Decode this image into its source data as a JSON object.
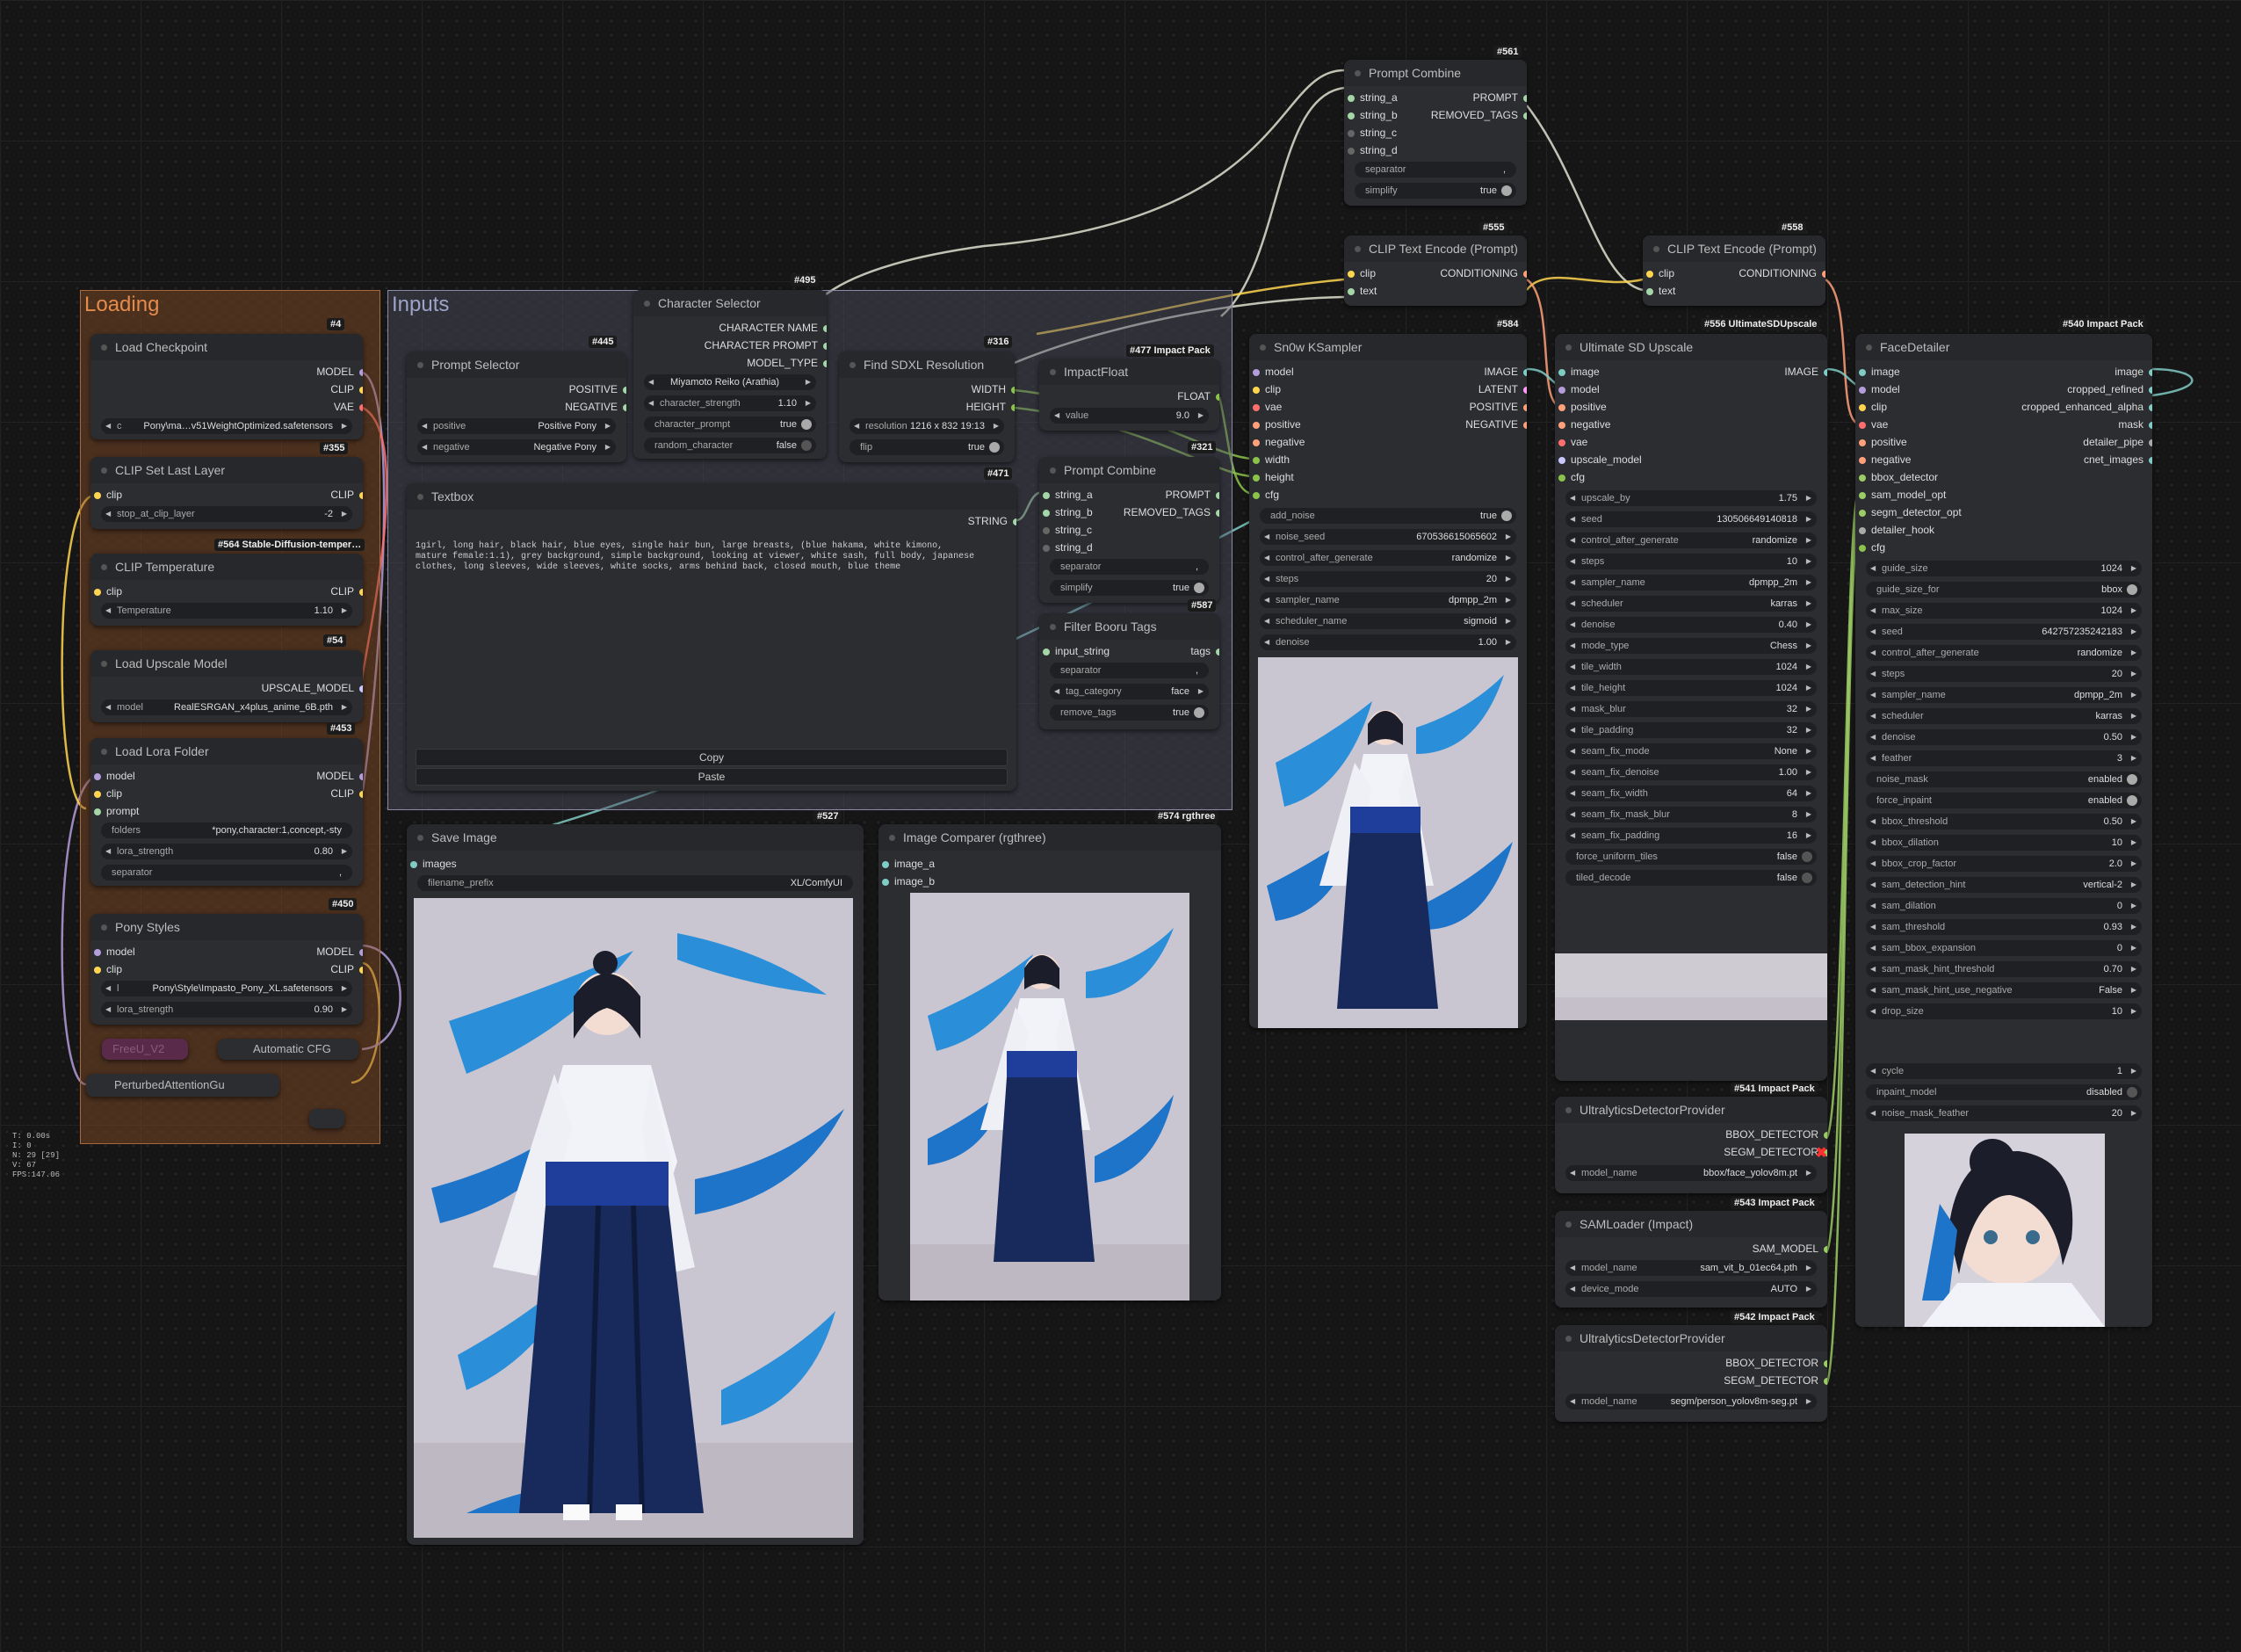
{
  "groups": {
    "loading": "Loading",
    "inputs": "Inputs"
  },
  "stats": [
    "T: 0.00s",
    "I: 0",
    "N: 29 [29]",
    "V: 67",
    "FPS:147.06"
  ],
  "textbox_text": "1girl, long hair, black hair, blue eyes, single hair bun, large breasts, (blue hakama, white kimono, mature female:1.1), grey background, simple background, looking at viewer, white sash, full body, japanese clothes, long sleeves, wide sleeves, white socks, arms behind back, closed mouth, blue theme",
  "nodes": {
    "load_checkpoint": {
      "title": "Load Checkpoint",
      "badge": "#4",
      "out": [
        "MODEL",
        "CLIP",
        "VAE"
      ],
      "ckpt": "Pony\\ma…v51WeightOptimized.safetensors",
      "ckpt_label": "c"
    },
    "clip_set_last": {
      "title": "CLIP Set Last Layer",
      "badge": "#355",
      "in": "clip",
      "out": "CLIP",
      "w_label": "stop_at_clip_layer",
      "w_val": "-2"
    },
    "clip_temp": {
      "title": "CLIP Temperature",
      "badge": "#564 Stable-Diffusion-temper…",
      "in": "clip",
      "out": "CLIP",
      "w_label": "Temperature",
      "w_val": "1.10"
    },
    "load_upscale": {
      "title": "Load Upscale Model",
      "badge": "#54",
      "out": "UPSCALE_MODEL",
      "w_label": "model",
      "w_val": "RealESRGAN_x4plus_anime_6B.pth"
    },
    "lora_folder": {
      "title": "Load Lora Folder",
      "badge": "#453",
      "in": [
        "model",
        "clip",
        "prompt"
      ],
      "out": [
        "MODEL",
        "CLIP"
      ],
      "folders_label": "folders",
      "folders_val": "*pony,character:1,concept,-sty",
      "lora_strength": "0.80",
      "separator_label": "separator",
      "separator_val": ","
    },
    "pony_styles": {
      "title": "Pony Styles",
      "badge": "#450",
      "in": [
        "model",
        "clip"
      ],
      "out": [
        "MODEL",
        "CLIP"
      ],
      "lora_label": "l",
      "lora_val": "Pony\\Style\\Impasto_Pony_XL.safetensors",
      "strength": "0.90"
    },
    "freeu": {
      "title": "FreeU_V2"
    },
    "auto_cfg": {
      "title": "Automatic CFG"
    },
    "pag": {
      "title": "PerturbedAttentionGu"
    },
    "prompt_selector": {
      "title": "Prompt Selector",
      "badge": "#445",
      "out": [
        "POSITIVE",
        "NEGATIVE"
      ],
      "positive": "Positive Pony",
      "negative": "Negative Pony",
      "positive_label": "positive",
      "negative_label": "negative"
    },
    "char_selector": {
      "title": "Character Selector",
      "badge": "#495",
      "out": [
        "CHARACTER NAME",
        "CHARACTER PROMPT",
        "MODEL_TYPE"
      ],
      "character": "Miyamoto Reiko (Arathia)",
      "character_strength": "1.10",
      "character_prompt": "true",
      "random_character": "false"
    },
    "sdxl_res": {
      "title": "Find SDXL Resolution",
      "badge": "#316",
      "out": [
        "WIDTH",
        "HEIGHT"
      ],
      "resolution": "1216 x 832 19:13",
      "resolution_label": "resolution",
      "flip": "true"
    },
    "textbox": {
      "title": "Textbox",
      "badge": "#471",
      "out": "STRING",
      "copy": "Copy",
      "paste": "Paste"
    },
    "impact_float": {
      "title": "ImpactFloat",
      "badge": "#477 Impact Pack",
      "out": "FLOAT",
      "w_label": "value",
      "w_val": "9.0"
    },
    "prompt_combine2": {
      "title": "Prompt Combine",
      "badge": "#321",
      "in": [
        "string_a",
        "string_b",
        "string_c",
        "string_d"
      ],
      "out": [
        "PROMPT",
        "REMOVED_TAGS"
      ],
      "separator": ",",
      "simplify": "true"
    },
    "filter_booru": {
      "title": "Filter Booru Tags",
      "badge": "#587",
      "in": "input_string",
      "out": "tags",
      "separator": ",",
      "tag_category": "face",
      "remove_tags": "true"
    },
    "prompt_combine1": {
      "title": "Prompt Combine",
      "badge": "#561",
      "in": [
        "string_a",
        "string_b",
        "string_c",
        "string_d"
      ],
      "out": [
        "PROMPT",
        "REMOVED_TAGS"
      ],
      "separator": ",",
      "simplify": "true"
    },
    "clip_text1": {
      "title": "CLIP Text Encode (Prompt)",
      "badge": "#555",
      "in": [
        "clip",
        "text"
      ],
      "out": "CONDITIONING"
    },
    "clip_text2": {
      "title": "CLIP Text Encode (Prompt)",
      "badge": "#558",
      "in": [
        "clip",
        "text"
      ],
      "out": "CONDITIONING"
    },
    "ksampler": {
      "title": "Sn0w KSampler",
      "badge": "#584",
      "in": [
        "model",
        "clip",
        "vae",
        "positive",
        "negative",
        "width",
        "height",
        "cfg"
      ],
      "out": [
        "IMAGE",
        "LATENT",
        "POSITIVE",
        "NEGATIVE"
      ],
      "widgets": [
        [
          "add_noise",
          "true",
          "t"
        ],
        [
          "noise_seed",
          "670536615065602",
          "a"
        ],
        [
          "control_after_generate",
          "randomize",
          "a"
        ],
        [
          "steps",
          "20",
          "a"
        ],
        [
          "sampler_name",
          "dpmpp_2m",
          "a"
        ],
        [
          "scheduler_name",
          "sigmoid",
          "a"
        ],
        [
          "denoise",
          "1.00",
          "a"
        ]
      ]
    },
    "ultimate_sd": {
      "title": "Ultimate SD Upscale",
      "badge": "#556 UltimateSDUpscale",
      "in": [
        "image",
        "model",
        "positive",
        "negative",
        "vae",
        "upscale_model",
        "cfg"
      ],
      "out": "IMAGE",
      "widgets": [
        [
          "upscale_by",
          "1.75",
          "a"
        ],
        [
          "seed",
          "130506649140818",
          "a"
        ],
        [
          "control_after_generate",
          "randomize",
          "a"
        ],
        [
          "steps",
          "10",
          "a"
        ],
        [
          "sampler_name",
          "dpmpp_2m",
          "a"
        ],
        [
          "scheduler",
          "karras",
          "a"
        ],
        [
          "denoise",
          "0.40",
          "a"
        ],
        [
          "mode_type",
          "Chess",
          "a"
        ],
        [
          "tile_width",
          "1024",
          "a"
        ],
        [
          "tile_height",
          "1024",
          "a"
        ],
        [
          "mask_blur",
          "32",
          "a"
        ],
        [
          "tile_padding",
          "32",
          "a"
        ],
        [
          "seam_fix_mode",
          "None",
          "a"
        ],
        [
          "seam_fix_denoise",
          "1.00",
          "a"
        ],
        [
          "seam_fix_width",
          "64",
          "a"
        ],
        [
          "seam_fix_mask_blur",
          "8",
          "a"
        ],
        [
          "seam_fix_padding",
          "16",
          "a"
        ],
        [
          "force_uniform_tiles",
          "false",
          "t"
        ],
        [
          "tiled_decode",
          "false",
          "t"
        ]
      ]
    },
    "face_detailer": {
      "title": "FaceDetailer",
      "badge": "#540 Impact Pack",
      "in": [
        "image",
        "model",
        "clip",
        "vae",
        "positive",
        "negative",
        "bbox_detector",
        "sam_model_opt",
        "segm_detector_opt",
        "detailer_hook",
        "cfg"
      ],
      "out": [
        "image",
        "cropped_refined",
        "cropped_enhanced_alpha",
        "mask",
        "detailer_pipe",
        "cnet_images"
      ],
      "widgets": [
        [
          "guide_size",
          "1024",
          "a"
        ],
        [
          "guide_size_for",
          "bbox",
          "t"
        ],
        [
          "max_size",
          "1024",
          "a"
        ],
        [
          "seed",
          "642757235242183",
          "a"
        ],
        [
          "control_after_generate",
          "randomize",
          "a"
        ],
        [
          "steps",
          "20",
          "a"
        ],
        [
          "sampler_name",
          "dpmpp_2m",
          "a"
        ],
        [
          "scheduler",
          "karras",
          "a"
        ],
        [
          "denoise",
          "0.50",
          "a"
        ],
        [
          "feather",
          "3",
          "a"
        ],
        [
          "noise_mask",
          "enabled",
          "t"
        ],
        [
          "force_inpaint",
          "enabled",
          "t"
        ],
        [
          "bbox_threshold",
          "0.50",
          "a"
        ],
        [
          "bbox_dilation",
          "10",
          "a"
        ],
        [
          "bbox_crop_factor",
          "2.0",
          "a"
        ],
        [
          "sam_detection_hint",
          "vertical-2",
          "a"
        ],
        [
          "sam_dilation",
          "0",
          "a"
        ],
        [
          "sam_threshold",
          "0.93",
          "a"
        ],
        [
          "sam_bbox_expansion",
          "0",
          "a"
        ],
        [
          "sam_mask_hint_threshold",
          "0.70",
          "a"
        ],
        [
          "sam_mask_hint_use_negative",
          "False",
          "a"
        ],
        [
          "drop_size",
          "10",
          "a"
        ]
      ],
      "widgets2": [
        [
          "cycle",
          "1",
          "a"
        ],
        [
          "inpaint_model",
          "disabled",
          "t"
        ],
        [
          "noise_mask_feather",
          "20",
          "a"
        ]
      ]
    },
    "ultra1": {
      "title": "UltralyticsDetectorProvider",
      "badge": "#541 Impact Pack",
      "out": [
        "BBOX_DETECTOR",
        "SEGM_DETECTOR"
      ],
      "model_label": "model_name",
      "model": "bbox/face_yolov8m.pt"
    },
    "samloader": {
      "title": "SAMLoader (Impact)",
      "badge": "#543 Impact Pack",
      "out": "SAM_MODEL",
      "model_label": "model_name",
      "model": "sam_vit_b_01ec64.pth",
      "device_label": "device_mode",
      "device": "AUTO"
    },
    "ultra2": {
      "title": "UltralyticsDetectorProvider",
      "badge": "#542 Impact Pack",
      "out": [
        "BBOX_DETECTOR",
        "SEGM_DETECTOR"
      ],
      "model_label": "model_name",
      "model": "segm/person_yolov8m-seg.pt"
    },
    "save_image": {
      "title": "Save Image",
      "badge": "#527",
      "in": "images",
      "prefix_label": "filename_prefix",
      "prefix": "XL/ComfyUI"
    },
    "comparer": {
      "title": "Image Comparer (rgthree)",
      "badge": "#574 rgthree",
      "in": [
        "image_a",
        "image_b"
      ]
    }
  },
  "colors": {
    "model": "#b39ddb",
    "clip": "#ffd54f",
    "vae": "#ff6e6e",
    "cond": "#ffa07a",
    "image": "#80cbc4",
    "string": "#a5d6a7",
    "int": "#8bc34a",
    "float": "#8bc34a",
    "upscale": "#c8c8ff",
    "sam": "#9ccc65"
  }
}
